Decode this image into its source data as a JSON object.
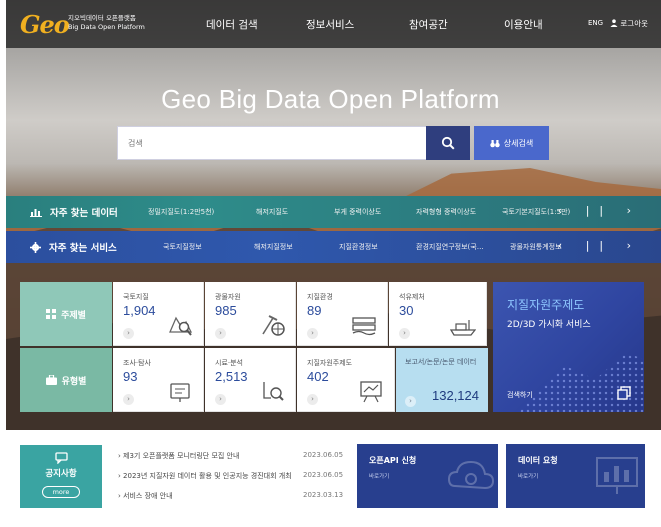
{
  "header": {
    "logo_mark": "Geo",
    "logo_line1": "지오빅데이터 오픈플랫폼",
    "logo_line2": "Big Data Open Platform",
    "menu": [
      "데이터 검색",
      "정보서비스",
      "참여공간",
      "이용안내"
    ],
    "lang": "ENG",
    "logout": "로그아웃"
  },
  "hero": {
    "title": "Geo Big Data Open Platform",
    "search_placeholder": "검색",
    "advanced_search": "상세검색"
  },
  "frequent_data": {
    "title": "자주 찾는 데이터",
    "items": [
      "정밀지질도(1:2만5천)",
      "해저지질도",
      "부게 중력이상도",
      "자력형형 중력이상도",
      "국토기본지질도(1:5만)"
    ],
    "controls": "‹ || ›"
  },
  "frequent_services": {
    "title": "자주 찾는 서비스",
    "items": [
      "국토지질정보",
      "해저지질정보",
      "지질환경정보",
      "환경지질연구정보(국…",
      "광물자원통계정보"
    ],
    "controls": "‹ || ›"
  },
  "categories": {
    "theme": "주제별",
    "type": "유형별"
  },
  "theme_cards": [
    {
      "label": "국토지질",
      "count": "1,904",
      "icon": "map-search-icon"
    },
    {
      "label": "광물자원",
      "count": "985",
      "icon": "mineral-tool-icon"
    },
    {
      "label": "지질환경",
      "count": "89",
      "icon": "environment-layers-icon"
    },
    {
      "label": "석유제처",
      "count": "30",
      "icon": "oil-ship-icon"
    }
  ],
  "type_cards": [
    {
      "label": "조사·탐사",
      "count": "93",
      "icon": "survey-device-icon"
    },
    {
      "label": "시료·분석",
      "count": "2,513",
      "icon": "sample-analysis-icon"
    },
    {
      "label": "지질자원주제도",
      "count": "402",
      "icon": "theme-map-board-icon"
    }
  ],
  "report_card": {
    "label": "보고서/논문/논문 데이터",
    "count": "132,124"
  },
  "promo": {
    "title": "지질자원주제도",
    "subtitle": "2D/3D 가시화 서비스",
    "link": "검색하기"
  },
  "notice": {
    "title": "공지사항",
    "more": "more",
    "items": [
      {
        "title": "제3기 오픈플랫폼 모니터링단 모집 안내",
        "date": "2023.06.05"
      },
      {
        "title": "2023년 지질자원 데이터 활용 및 인공지능 경진대회 개최",
        "date": "2023.06.05"
      },
      {
        "title": "서비스 장애 안내",
        "date": "2023.03.13"
      }
    ]
  },
  "openapi": {
    "title": "오픈API 신청",
    "sub": "바로가기"
  },
  "data_request": {
    "title": "데이터 요청",
    "sub": "바로가기"
  },
  "colors": {
    "nav_bg": "#222222",
    "teal_bar": "#2e8c8a",
    "blue_bar": "#2f58ad",
    "navy": "#283f8e",
    "count_blue": "#2c4c9c",
    "notice_teal": "#3aa4a2"
  }
}
